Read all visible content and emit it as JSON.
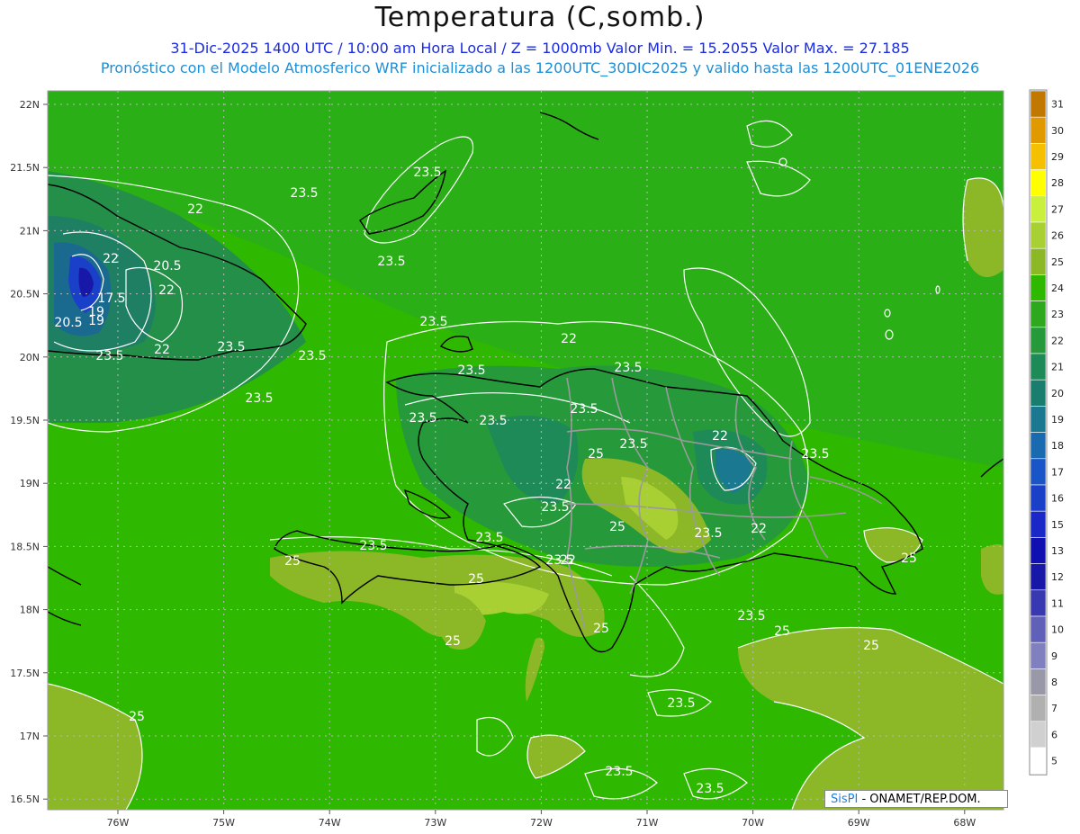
{
  "title": "Temperatura (C,somb.)",
  "subtitle_line1": "31-Dic-2025 1400 UTC / 10:00 am Hora Local / Z = 1000mb   Valor Min. = 15.2055  Valor Max. = 27.185",
  "subtitle_line2": "Pronóstico con el Modelo Atmosferico WRF inicializado a las 1200UTC_30DIC2025 y valido hasta las  1200UTC_01ENE2026",
  "credit": {
    "brand": "SisPI",
    "org": " - ONAMET/REP.DOM."
  },
  "lat_labels": [
    "22N",
    "21.5N",
    "21N",
    "20.5N",
    "20N",
    "19.5N",
    "19N",
    "18.5N",
    "18N",
    "17.5N",
    "17N",
    "16.5N"
  ],
  "lon_labels": [
    "76W",
    "75W",
    "74W",
    "73W",
    "72W",
    "71W",
    "70W",
    "69W",
    "68W"
  ],
  "colorbar": {
    "values": [
      31,
      30,
      29,
      28,
      27,
      26,
      25,
      24,
      23,
      22,
      21,
      20,
      19,
      18,
      17,
      16,
      15,
      13,
      12,
      11,
      10,
      9,
      8,
      7,
      6,
      5
    ],
    "colors": [
      "#c07800",
      "#e09a00",
      "#f5c000",
      "#ffff00",
      "#c8f03c",
      "#a8d032",
      "#8cb828",
      "#2eb800",
      "#2ea81c",
      "#269a3a",
      "#1e8a58",
      "#1a7e6e",
      "#1a7890",
      "#1a6ab0",
      "#1a55c8",
      "#1a40c8",
      "#1a28c8",
      "#1010b0",
      "#1818a8",
      "#3838b0",
      "#6060b8",
      "#8080c0",
      "#9898a8",
      "#b0b0b0",
      "#d0d0d0",
      "#ffffff"
    ]
  },
  "contour_labels": [
    {
      "text": "23.5"
    },
    {
      "text": "22"
    },
    {
      "text": "23.5"
    },
    {
      "text": "23.5"
    },
    {
      "text": "22"
    },
    {
      "text": "20.5"
    },
    {
      "text": "22"
    },
    {
      "text": "19"
    },
    {
      "text": "17.5"
    },
    {
      "text": "20.5"
    },
    {
      "text": "19"
    },
    {
      "text": "23.5"
    },
    {
      "text": "22"
    },
    {
      "text": "23.5"
    },
    {
      "text": "23.5"
    },
    {
      "text": "23.5"
    },
    {
      "text": "23.5"
    },
    {
      "text": "23.5"
    },
    {
      "text": "23.5"
    },
    {
      "text": "22"
    },
    {
      "text": "23.5"
    },
    {
      "text": "23.5"
    },
    {
      "text": "23.5"
    },
    {
      "text": "23.5"
    },
    {
      "text": "23.5"
    },
    {
      "text": "22"
    },
    {
      "text": "22"
    },
    {
      "text": "23.5"
    },
    {
      "text": "25"
    },
    {
      "text": "22"
    },
    {
      "text": "23.5"
    },
    {
      "text": "25"
    },
    {
      "text": "23.5"
    },
    {
      "text": "23.5"
    },
    {
      "text": "22"
    },
    {
      "text": "23.5"
    },
    {
      "text": "25"
    },
    {
      "text": "25"
    },
    {
      "text": "25"
    },
    {
      "text": "25"
    },
    {
      "text": "25"
    },
    {
      "text": "23.5"
    },
    {
      "text": "25"
    },
    {
      "text": "25"
    },
    {
      "text": "25"
    },
    {
      "text": "23.5"
    },
    {
      "text": "23.5"
    },
    {
      "text": "23.5"
    }
  ]
}
